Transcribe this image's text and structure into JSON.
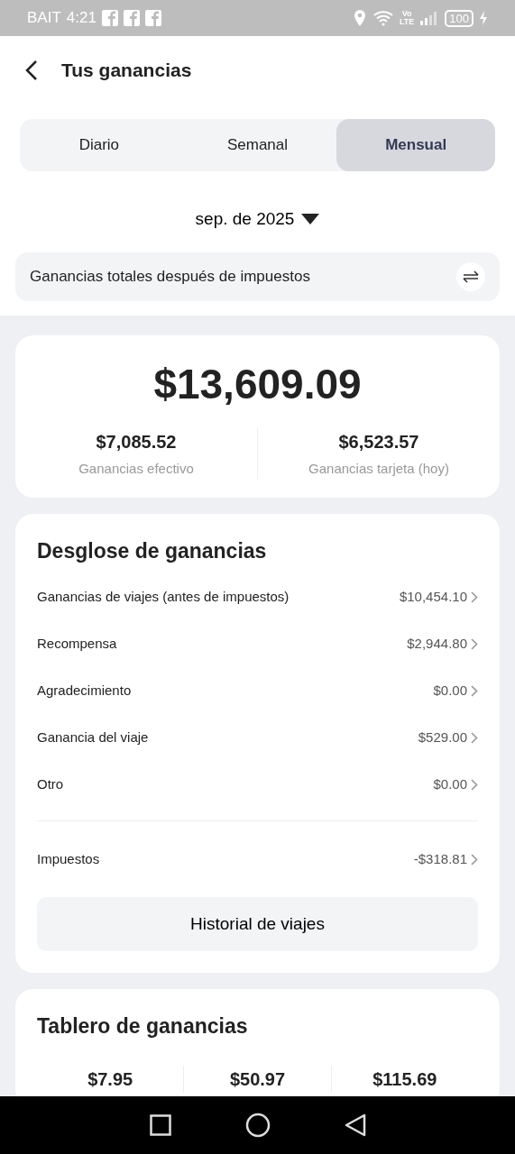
{
  "status_bar": {
    "carrier": "BAIT",
    "time": "4:21",
    "notifications": [
      {
        "kind": "facebook"
      },
      {
        "kind": "facebook"
      },
      {
        "kind": "facebook"
      }
    ],
    "volte": [
      "Vo",
      "LTE"
    ],
    "battery": "100"
  },
  "header": {
    "title": "Tus ganancias"
  },
  "tabs": [
    {
      "label": "Diario",
      "selected": false
    },
    {
      "label": "Semanal",
      "selected": false
    },
    {
      "label": "Mensual",
      "selected": true
    }
  ],
  "period": {
    "label": "sep. de 2025"
  },
  "filter": {
    "label": "Ganancias totales después de impuestos"
  },
  "summary": {
    "total": "$13,609.09",
    "parts": [
      {
        "amount": "$7,085.52",
        "label": "Ganancias efectivo"
      },
      {
        "amount": "$6,523.57",
        "label": "Ganancias tarjeta (hoy)"
      }
    ]
  },
  "breakdown": {
    "title": "Desglose de ganancias",
    "rows": [
      {
        "label": "Ganancias de viajes (antes de impuestos)",
        "value": "$10,454.10"
      },
      {
        "label": "Recompensa",
        "value": "$2,944.80"
      },
      {
        "label": "Agradecimiento",
        "value": "$0.00"
      },
      {
        "label": "Ganancia del viaje",
        "value": "$529.00"
      },
      {
        "label": "Otro",
        "value": "$0.00"
      }
    ],
    "tax": {
      "label": "Impuestos",
      "value": "-$318.81"
    },
    "button": "Historial de viajes"
  },
  "dashboard": {
    "title": "Tablero de ganancias",
    "values": [
      "$7.95",
      "$50.97",
      "$115.69"
    ]
  }
}
